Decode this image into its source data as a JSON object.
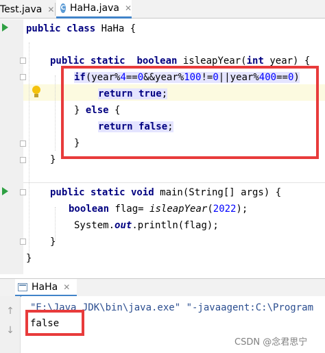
{
  "tabs": [
    {
      "label": "Test.java",
      "active": false
    },
    {
      "label": "HaHa.java",
      "active": true
    }
  ],
  "code": {
    "line1": {
      "t1": "public class",
      "t2": " HaHa {"
    },
    "line2": {
      "t1": "public static",
      "t2": "  ",
      "t3": "boolean",
      "t4": " isleapYear(",
      "t5": "int",
      "t6": " year) {"
    },
    "line3": {
      "t1": "if",
      "t2": "(year%",
      "n1": "4",
      "t3": "==",
      "n2": "0",
      "t4": "&&year%",
      "n3": "100",
      "t5": "!=",
      "n4": "0",
      "t6": "||year%",
      "n5": "400",
      "t7": "==",
      "n6": "0",
      "t8": ")"
    },
    "line4": {
      "t1": "return true",
      "t2": ";"
    },
    "line5": {
      "t1": "} ",
      "t2": "else",
      "t3": " {"
    },
    "line6": {
      "t1": "return false",
      "t2": ";"
    },
    "line7": "}",
    "line8": "}",
    "line9": {
      "t1": "public static void",
      "t2": " main(String[] args) {"
    },
    "line10": {
      "t1": "boolean",
      "t2": " flag= ",
      "t3": "isleapYear",
      "t4": "(",
      "n1": "2022",
      "t5": ");"
    },
    "line11": {
      "t1": "System.",
      "t2": "out",
      "t3": ".println(flag);"
    },
    "line12": "}",
    "line13": "}"
  },
  "run_panel": {
    "tab_label": "HaHa",
    "command_line": "\"E:\\Java JDK\\bin\\java.exe\" \"-javaagent:C:\\Program",
    "output": "false"
  },
  "watermark": "CSDN @念君思宁",
  "colors": {
    "keyword": "#000080",
    "number": "#0000ff",
    "highlight_box": "#e83b3b",
    "run_arrow": "#2ea043",
    "active_tab_underline": "#4083c9"
  }
}
